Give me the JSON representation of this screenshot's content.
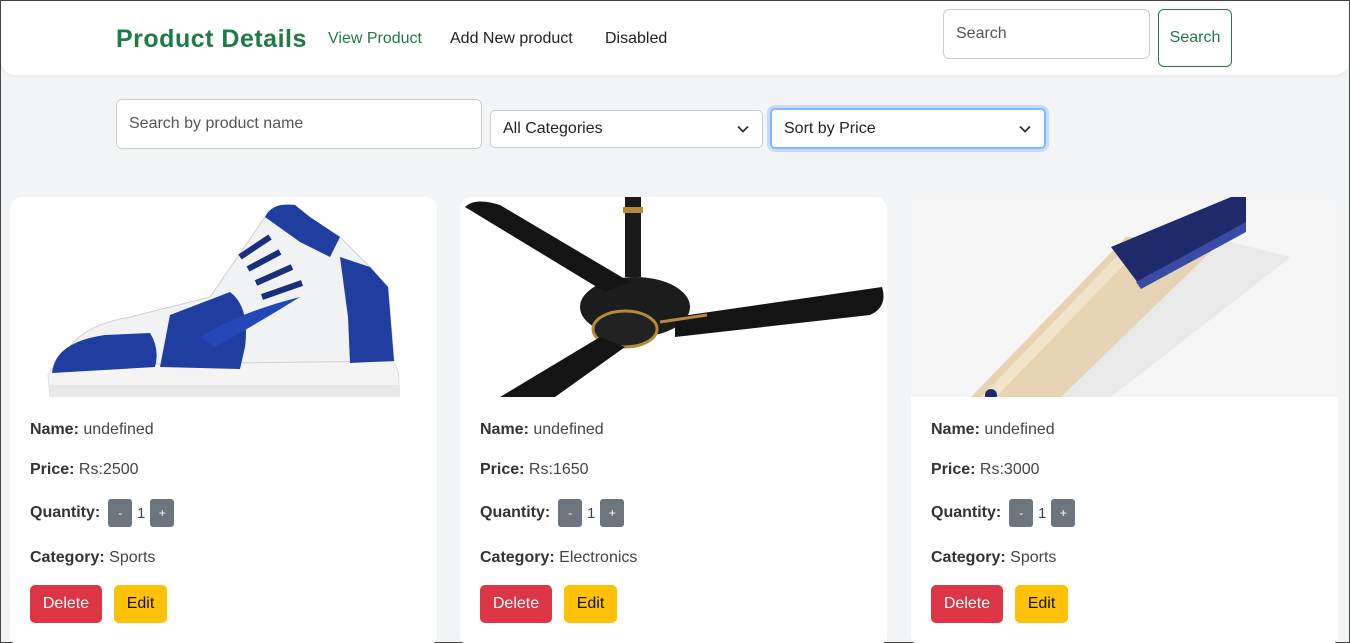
{
  "navbar": {
    "brand": "Product Details",
    "links": [
      "View Product",
      "Add New product",
      "Disabled"
    ],
    "search_placeholder": "Search",
    "search_button": "Search"
  },
  "filters": {
    "search_placeholder": "Search by product name",
    "category_selected": "All Categories",
    "sort_selected": "Sort by Price"
  },
  "labels": {
    "name": "Name:",
    "price": "Price:",
    "quantity": "Quantity:",
    "category": "Category:",
    "minus": "-",
    "plus": "+",
    "delete": "Delete",
    "edit": "Edit"
  },
  "products": [
    {
      "image": "sneaker-image",
      "name": "undefined",
      "price": "Rs:2500",
      "quantity": "1",
      "category": "Sports"
    },
    {
      "image": "ceiling-fan-image",
      "name": "undefined",
      "price": "Rs:1650",
      "quantity": "1",
      "category": "Electronics"
    },
    {
      "image": "cricket-bat-image",
      "name": "undefined",
      "price": "Rs:3000",
      "quantity": "1",
      "category": "Sports"
    }
  ],
  "colors": {
    "brand": "#1f7a46",
    "delete": "#dc3545",
    "edit": "#ffc107",
    "qty": "#6c757d"
  }
}
